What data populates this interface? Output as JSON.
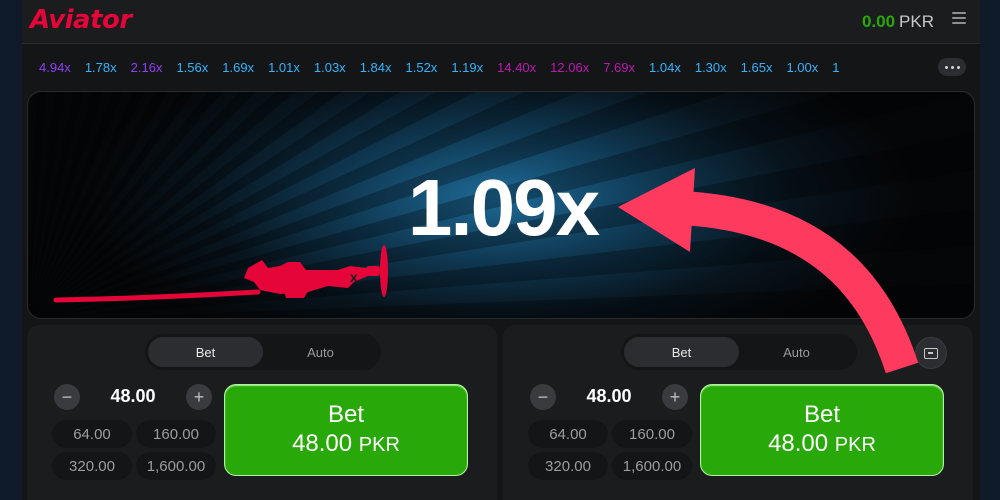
{
  "app": {
    "logo": "Aviator"
  },
  "header": {
    "balance": "0.00",
    "currency": "PKR",
    "menu_icon": "hamburger-menu-icon"
  },
  "history": [
    {
      "value": "4.94x",
      "color": "purple"
    },
    {
      "value": "1.78x",
      "color": "blue"
    },
    {
      "value": "2.16x",
      "color": "purple"
    },
    {
      "value": "1.56x",
      "color": "blue"
    },
    {
      "value": "1.69x",
      "color": "blue"
    },
    {
      "value": "1.01x",
      "color": "blue"
    },
    {
      "value": "1.03x",
      "color": "blue"
    },
    {
      "value": "1.84x",
      "color": "blue"
    },
    {
      "value": "1.52x",
      "color": "blue"
    },
    {
      "value": "1.19x",
      "color": "blue"
    },
    {
      "value": "14.40x",
      "color": "pink"
    },
    {
      "value": "12.06x",
      "color": "pink"
    },
    {
      "value": "7.69x",
      "color": "pink"
    },
    {
      "value": "1.04x",
      "color": "blue"
    },
    {
      "value": "1.30x",
      "color": "blue"
    },
    {
      "value": "1.65x",
      "color": "blue"
    },
    {
      "value": "1.00x",
      "color": "blue"
    },
    {
      "value": "1",
      "color": "blue"
    }
  ],
  "game": {
    "multiplier": "1.09x"
  },
  "colors": {
    "brand": "#e50539",
    "bet_green": "#28a909",
    "history_blue": "#34b4ff",
    "history_purple": "#913ef8",
    "history_pink": "#c017b4",
    "arrow": "#fe3a5f"
  },
  "panels": [
    {
      "tab_bet": "Bet",
      "tab_auto": "Auto",
      "amount": "48.00",
      "quick": [
        "64.00",
        "160.00",
        "320.00",
        "1,600.00"
      ],
      "bet_label": "Bet",
      "bet_amount": "48.00",
      "bet_currency": "PKR"
    },
    {
      "tab_bet": "Bet",
      "tab_auto": "Auto",
      "amount": "48.00",
      "quick": [
        "64.00",
        "160.00",
        "320.00",
        "1,600.00"
      ],
      "bet_label": "Bet",
      "bet_amount": "48.00",
      "bet_currency": "PKR"
    }
  ]
}
